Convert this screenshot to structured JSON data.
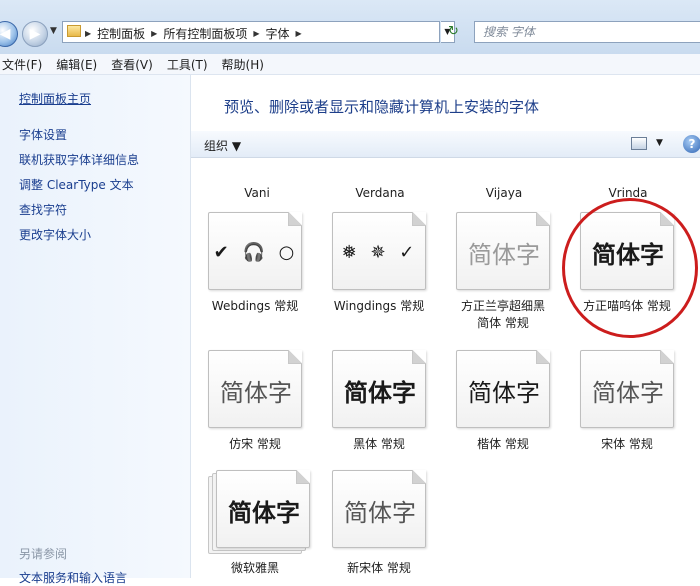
{
  "address": {
    "crumbs": [
      "控制面板",
      "所有控制面板项",
      "字体"
    ],
    "search_placeholder": "搜索 字体"
  },
  "menu": [
    "文件(F)",
    "编辑(E)",
    "查看(V)",
    "工具(T)",
    "帮助(H)"
  ],
  "left_pane": {
    "home": "控制面板主页",
    "links": [
      "字体设置",
      "联机获取字体详细信息",
      "调整 ClearType 文本",
      "查找字符",
      "更改字体大小"
    ],
    "see_also": "另请参阅",
    "extra": "文本服务和输入语言"
  },
  "header": "预览、删除或者显示和隐藏计算机上安装的字体",
  "toolbar": {
    "organize": "组织"
  },
  "top_row": [
    "Vani",
    "Verdana",
    "Vijaya",
    "Vrinda"
  ],
  "fonts": [
    {
      "name": "Webdings 常规",
      "preview": "✔ 🎧 ○"
    },
    {
      "name": "Wingdings 常规",
      "preview": "❅ ✵ ✓"
    },
    {
      "name": "方正兰亭超细黑\n简体 常规",
      "preview": "简体字"
    },
    {
      "name": "方正喵呜体 常规",
      "preview": "简体字"
    },
    {
      "name": "仿宋 常规",
      "preview": "简体字"
    },
    {
      "name": "黑体 常规",
      "preview": "简体字"
    },
    {
      "name": "楷体 常规",
      "preview": "简体字"
    },
    {
      "name": "宋体 常规",
      "preview": "简体字"
    },
    {
      "name": "微软雅黑",
      "preview": "简体字"
    },
    {
      "name": "新宋体 常规",
      "preview": "简体字"
    }
  ],
  "colors": {
    "link": "#1a3e8f",
    "header": "#1e3f8a",
    "highlight_circle": "#cc1d1d"
  }
}
